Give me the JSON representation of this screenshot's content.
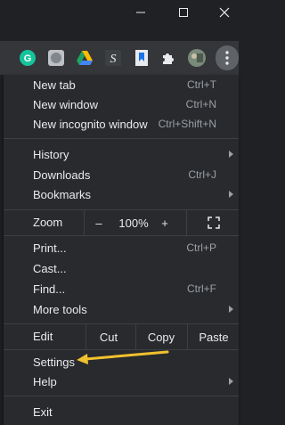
{
  "window": {
    "minimize_icon": "minimize-icon",
    "maximize_icon": "maximize-icon",
    "close_icon": "close-icon"
  },
  "toolbar": {
    "extensions": [
      {
        "name": "grammarly-extension-icon",
        "color": "#15c39a"
      },
      {
        "name": "gray-extension-icon",
        "color": "#9aa0a6"
      },
      {
        "name": "google-drive-extension-icon",
        "color": "#fbbc04"
      },
      {
        "name": "s-extension-icon",
        "color": "#e8eaed"
      },
      {
        "name": "bookmark-extension-icon",
        "color": "#e8eaed"
      },
      {
        "name": "puzzle-extensions-icon",
        "color": "#e8eaed"
      },
      {
        "name": "profile-avatar",
        "color": "#7a8a7a"
      }
    ],
    "menu_icon": "three-dots-vertical-icon"
  },
  "menu": {
    "new_tab": {
      "label": "New tab",
      "shortcut": "Ctrl+T"
    },
    "new_window": {
      "label": "New window",
      "shortcut": "Ctrl+N"
    },
    "new_incognito": {
      "label": "New incognito window",
      "shortcut": "Ctrl+Shift+N"
    },
    "history": {
      "label": "History"
    },
    "downloads": {
      "label": "Downloads",
      "shortcut": "Ctrl+J"
    },
    "bookmarks": {
      "label": "Bookmarks"
    },
    "zoom": {
      "label": "Zoom",
      "minus": "–",
      "value": "100%",
      "plus": "+",
      "fullscreen_icon": "fullscreen-icon"
    },
    "print": {
      "label": "Print...",
      "shortcut": "Ctrl+P"
    },
    "cast": {
      "label": "Cast..."
    },
    "find": {
      "label": "Find...",
      "shortcut": "Ctrl+F"
    },
    "more_tools": {
      "label": "More tools"
    },
    "edit": {
      "label": "Edit",
      "cut": "Cut",
      "copy": "Copy",
      "paste": "Paste"
    },
    "settings": {
      "label": "Settings"
    },
    "help": {
      "label": "Help"
    },
    "exit": {
      "label": "Exit"
    }
  },
  "annotation": {
    "arrow_color": "#f2c12e"
  }
}
